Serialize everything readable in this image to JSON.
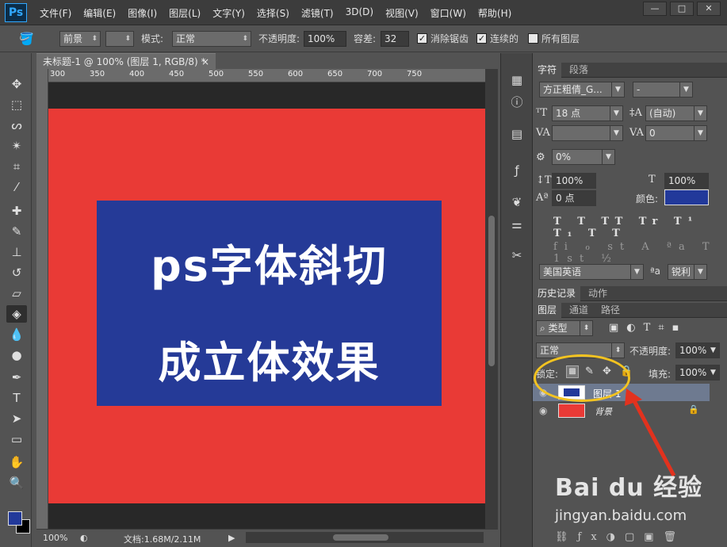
{
  "app": {
    "logo": "Ps",
    "menus": [
      "文件(F)",
      "编辑(E)",
      "图像(I)",
      "图层(L)",
      "文字(Y)",
      "选择(S)",
      "滤镜(T)",
      "3D(D)",
      "视图(V)",
      "窗口(W)",
      "帮助(H)"
    ],
    "window_buttons": [
      "—",
      "□",
      "✕"
    ]
  },
  "options": {
    "source_label": "前景",
    "mode_label": "模式:",
    "mode_value": "正常",
    "opacity_label": "不透明度:",
    "opacity_value": "100%",
    "tolerance_label": "容差:",
    "tolerance_value": "32",
    "antialias_label": "消除锯齿",
    "contiguous_label": "连续的",
    "all_layers_label": "所有图层"
  },
  "document": {
    "tab_title": "未标题-1 @ 100% (图层 1, RGB/8) *",
    "close": "×",
    "ruler_ticks": [
      "300",
      "350",
      "400",
      "450",
      "500",
      "550",
      "600",
      "650",
      "700",
      "750"
    ],
    "line1": "ps字体斜切",
    "line2": "成立体效果",
    "canvas_color": "#e93a36",
    "box_color": "#253a97"
  },
  "status": {
    "zoom": "100%",
    "doc_info": "文档:1.68M/2.11M",
    "arrow": "▶"
  },
  "character_panel": {
    "tab_char": "字符",
    "tab_para": "段落",
    "font_family": "方正粗倩_G...",
    "font_style": "-",
    "size": "18 点",
    "leading": "(自动)",
    "tracking": "0",
    "kerning": "",
    "scale_pct": "0%",
    "vscale": "100%",
    "hscale": "100%",
    "baseline": "0 点",
    "color_label": "颜色:",
    "color_value": "#22399a",
    "language": "美国英语",
    "aa_icon": "ªa",
    "aa_value": "锐利"
  },
  "history_panel": {
    "tab_history": "历史记录",
    "tab_actions": "动作"
  },
  "layers_panel": {
    "tab_layers": "图层",
    "tab_channels": "通道",
    "tab_paths": "路径",
    "filter_type": "类型",
    "blend_mode": "正常",
    "opacity_label": "不透明度:",
    "opacity_value": "100%",
    "lock_label": "锁定:",
    "fill_label": "填充:",
    "fill_value": "100%",
    "layers": [
      {
        "name": "图层 1",
        "selected": true
      },
      {
        "name": "背景",
        "selected": false
      }
    ]
  },
  "watermark": {
    "brand": "Bai du 经验",
    "url": "jingyan.baidu.com"
  }
}
